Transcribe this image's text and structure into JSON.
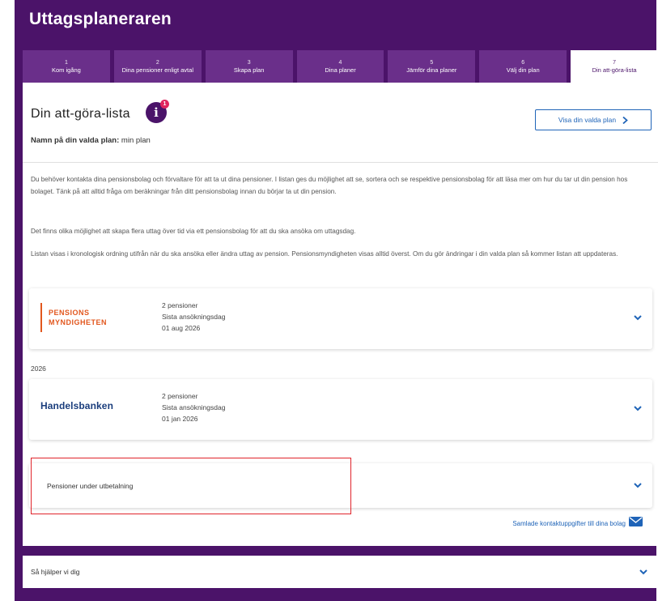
{
  "app": {
    "title": "Uttagsplaneraren"
  },
  "steps": [
    {
      "num": "1",
      "label": "Kom igång"
    },
    {
      "num": "2",
      "label": "Dina pensioner enligt avtal"
    },
    {
      "num": "3",
      "label": "Skapa plan"
    },
    {
      "num": "4",
      "label": "Dina planer"
    },
    {
      "num": "5",
      "label": "Jämför dina planer"
    },
    {
      "num": "6",
      "label": "Välj din plan"
    },
    {
      "num": "7",
      "label": "Din att-göra-lista"
    }
  ],
  "todo": {
    "title": "Din att-göra-lista",
    "badge_count": "1",
    "plan_name_label": "Namn på din valda plan:",
    "plan_name_value": "min plan",
    "show_plan_button": "Visa din valda plan"
  },
  "paragraphs": [
    "Du behöver kontakta dina pensionsbolag och förvaltare för att ta ut dina pensioner. I listan ges du möjlighet att se, sortera och se respektive pensionsbolag för att läsa mer om hur du tar ut din pension hos bolaget. Tänk på att alltid fråga om beräkningar från ditt pensionsbolag innan du börjar ta ut din pension.",
    "Det finns olika möjlighet att skapa flera uttag över tid via ett pensionsbolag för att du ska ansöka om uttagsdag.",
    "Listan visas i kronologisk ordning utifrån när du ska ansöka eller ändra uttag av pension. Pensionsmyndigheten visas alltid överst. Om du gör ändringar i din valda plan så kommer listan att uppdateras."
  ],
  "providers": [
    {
      "logo_line1": "PENSIONS",
      "logo_line2": "MYNDIGHETEN",
      "count": "2 pensioner",
      "date_label": "Sista ansökningsdag",
      "date": "01 aug 2026"
    },
    {
      "year": "2026",
      "logo": "Handelsbanken",
      "count": "2 pensioner",
      "date_label": "Sista ansökningsdag",
      "date": "01 jan 2026"
    }
  ],
  "pending": {
    "label": "Pensioner under utbetalning"
  },
  "contact": {
    "label": "Samlade kontaktuppgifter till dina bolag"
  },
  "bottom": {
    "label": "Så hjälper vi dig"
  },
  "colors": {
    "brand_purple": "#4b1369",
    "step_purple": "#6a2f8a",
    "link_blue": "#1f64b8",
    "pm_orange": "#e2571e",
    "highlight_red": "#e0242b"
  }
}
